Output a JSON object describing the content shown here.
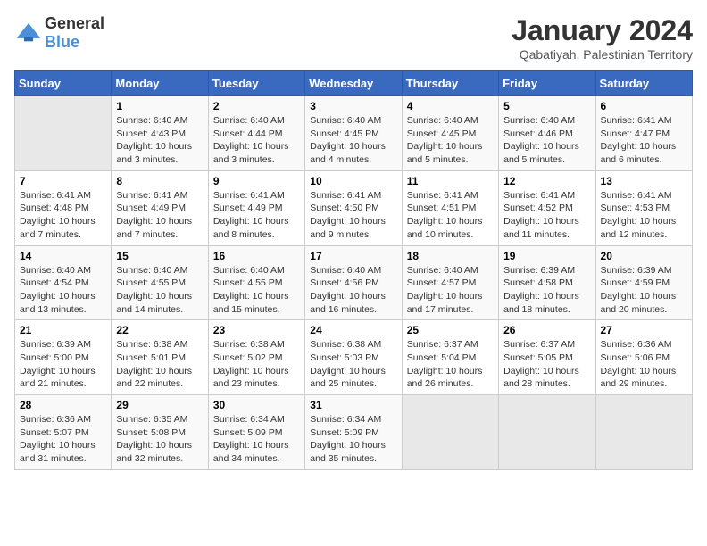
{
  "logo": {
    "text_general": "General",
    "text_blue": "Blue"
  },
  "title": "January 2024",
  "location": "Qabatiyah, Palestinian Territory",
  "columns": [
    "Sunday",
    "Monday",
    "Tuesday",
    "Wednesday",
    "Thursday",
    "Friday",
    "Saturday"
  ],
  "weeks": [
    [
      {
        "day": "",
        "empty": true
      },
      {
        "day": "1",
        "sunrise": "Sunrise: 6:40 AM",
        "sunset": "Sunset: 4:43 PM",
        "daylight": "Daylight: 10 hours and 3 minutes."
      },
      {
        "day": "2",
        "sunrise": "Sunrise: 6:40 AM",
        "sunset": "Sunset: 4:44 PM",
        "daylight": "Daylight: 10 hours and 3 minutes."
      },
      {
        "day": "3",
        "sunrise": "Sunrise: 6:40 AM",
        "sunset": "Sunset: 4:45 PM",
        "daylight": "Daylight: 10 hours and 4 minutes."
      },
      {
        "day": "4",
        "sunrise": "Sunrise: 6:40 AM",
        "sunset": "Sunset: 4:45 PM",
        "daylight": "Daylight: 10 hours and 5 minutes."
      },
      {
        "day": "5",
        "sunrise": "Sunrise: 6:40 AM",
        "sunset": "Sunset: 4:46 PM",
        "daylight": "Daylight: 10 hours and 5 minutes."
      },
      {
        "day": "6",
        "sunrise": "Sunrise: 6:41 AM",
        "sunset": "Sunset: 4:47 PM",
        "daylight": "Daylight: 10 hours and 6 minutes."
      }
    ],
    [
      {
        "day": "7",
        "sunrise": "Sunrise: 6:41 AM",
        "sunset": "Sunset: 4:48 PM",
        "daylight": "Daylight: 10 hours and 7 minutes."
      },
      {
        "day": "8",
        "sunrise": "Sunrise: 6:41 AM",
        "sunset": "Sunset: 4:49 PM",
        "daylight": "Daylight: 10 hours and 7 minutes."
      },
      {
        "day": "9",
        "sunrise": "Sunrise: 6:41 AM",
        "sunset": "Sunset: 4:49 PM",
        "daylight": "Daylight: 10 hours and 8 minutes."
      },
      {
        "day": "10",
        "sunrise": "Sunrise: 6:41 AM",
        "sunset": "Sunset: 4:50 PM",
        "daylight": "Daylight: 10 hours and 9 minutes."
      },
      {
        "day": "11",
        "sunrise": "Sunrise: 6:41 AM",
        "sunset": "Sunset: 4:51 PM",
        "daylight": "Daylight: 10 hours and 10 minutes."
      },
      {
        "day": "12",
        "sunrise": "Sunrise: 6:41 AM",
        "sunset": "Sunset: 4:52 PM",
        "daylight": "Daylight: 10 hours and 11 minutes."
      },
      {
        "day": "13",
        "sunrise": "Sunrise: 6:41 AM",
        "sunset": "Sunset: 4:53 PM",
        "daylight": "Daylight: 10 hours and 12 minutes."
      }
    ],
    [
      {
        "day": "14",
        "sunrise": "Sunrise: 6:40 AM",
        "sunset": "Sunset: 4:54 PM",
        "daylight": "Daylight: 10 hours and 13 minutes."
      },
      {
        "day": "15",
        "sunrise": "Sunrise: 6:40 AM",
        "sunset": "Sunset: 4:55 PM",
        "daylight": "Daylight: 10 hours and 14 minutes."
      },
      {
        "day": "16",
        "sunrise": "Sunrise: 6:40 AM",
        "sunset": "Sunset: 4:55 PM",
        "daylight": "Daylight: 10 hours and 15 minutes."
      },
      {
        "day": "17",
        "sunrise": "Sunrise: 6:40 AM",
        "sunset": "Sunset: 4:56 PM",
        "daylight": "Daylight: 10 hours and 16 minutes."
      },
      {
        "day": "18",
        "sunrise": "Sunrise: 6:40 AM",
        "sunset": "Sunset: 4:57 PM",
        "daylight": "Daylight: 10 hours and 17 minutes."
      },
      {
        "day": "19",
        "sunrise": "Sunrise: 6:39 AM",
        "sunset": "Sunset: 4:58 PM",
        "daylight": "Daylight: 10 hours and 18 minutes."
      },
      {
        "day": "20",
        "sunrise": "Sunrise: 6:39 AM",
        "sunset": "Sunset: 4:59 PM",
        "daylight": "Daylight: 10 hours and 20 minutes."
      }
    ],
    [
      {
        "day": "21",
        "sunrise": "Sunrise: 6:39 AM",
        "sunset": "Sunset: 5:00 PM",
        "daylight": "Daylight: 10 hours and 21 minutes."
      },
      {
        "day": "22",
        "sunrise": "Sunrise: 6:38 AM",
        "sunset": "Sunset: 5:01 PM",
        "daylight": "Daylight: 10 hours and 22 minutes."
      },
      {
        "day": "23",
        "sunrise": "Sunrise: 6:38 AM",
        "sunset": "Sunset: 5:02 PM",
        "daylight": "Daylight: 10 hours and 23 minutes."
      },
      {
        "day": "24",
        "sunrise": "Sunrise: 6:38 AM",
        "sunset": "Sunset: 5:03 PM",
        "daylight": "Daylight: 10 hours and 25 minutes."
      },
      {
        "day": "25",
        "sunrise": "Sunrise: 6:37 AM",
        "sunset": "Sunset: 5:04 PM",
        "daylight": "Daylight: 10 hours and 26 minutes."
      },
      {
        "day": "26",
        "sunrise": "Sunrise: 6:37 AM",
        "sunset": "Sunset: 5:05 PM",
        "daylight": "Daylight: 10 hours and 28 minutes."
      },
      {
        "day": "27",
        "sunrise": "Sunrise: 6:36 AM",
        "sunset": "Sunset: 5:06 PM",
        "daylight": "Daylight: 10 hours and 29 minutes."
      }
    ],
    [
      {
        "day": "28",
        "sunrise": "Sunrise: 6:36 AM",
        "sunset": "Sunset: 5:07 PM",
        "daylight": "Daylight: 10 hours and 31 minutes."
      },
      {
        "day": "29",
        "sunrise": "Sunrise: 6:35 AM",
        "sunset": "Sunset: 5:08 PM",
        "daylight": "Daylight: 10 hours and 32 minutes."
      },
      {
        "day": "30",
        "sunrise": "Sunrise: 6:34 AM",
        "sunset": "Sunset: 5:09 PM",
        "daylight": "Daylight: 10 hours and 34 minutes."
      },
      {
        "day": "31",
        "sunrise": "Sunrise: 6:34 AM",
        "sunset": "Sunset: 5:09 PM",
        "daylight": "Daylight: 10 hours and 35 minutes."
      },
      {
        "day": "",
        "empty": true
      },
      {
        "day": "",
        "empty": true
      },
      {
        "day": "",
        "empty": true
      }
    ]
  ]
}
